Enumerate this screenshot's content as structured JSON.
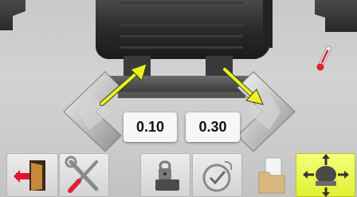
{
  "measurements": {
    "left_value": "0.10",
    "right_value": "0.30"
  },
  "toolbar": {
    "buttons": [
      {
        "name": "exit",
        "icon": "exit-door-icon",
        "active": false
      },
      {
        "name": "tools",
        "icon": "wrench-screwdriver-icon",
        "active": false
      },
      {
        "name": "lock",
        "icon": "lock-station-icon",
        "active": false
      },
      {
        "name": "check",
        "icon": "check-gauge-icon",
        "active": false
      },
      {
        "name": "folder",
        "icon": "folder-icon",
        "active": false
      },
      {
        "name": "machine-adjust",
        "icon": "machine-move-icon",
        "active": true
      }
    ]
  },
  "colors": {
    "arrow": "#e8f029",
    "active_button": "#e6f23a",
    "background": "#cccccc"
  }
}
